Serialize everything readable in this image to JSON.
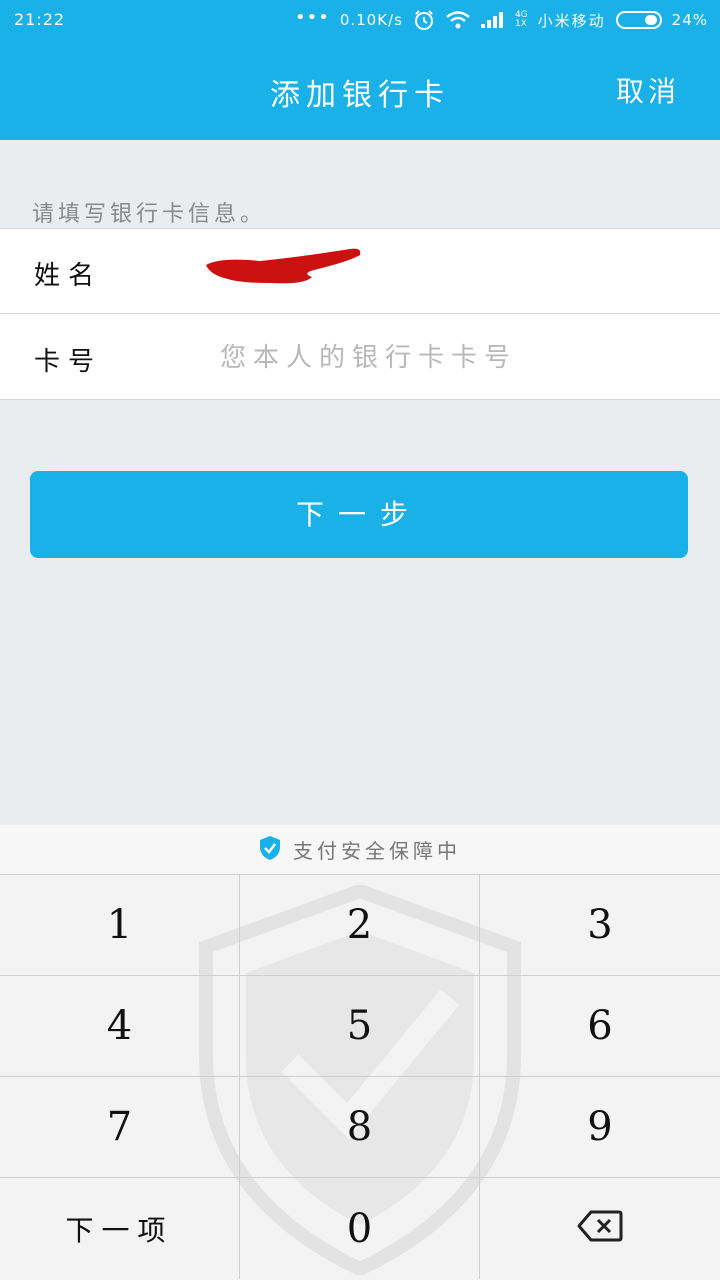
{
  "status_bar": {
    "time": "21:22",
    "dots": "•••",
    "net_speed": "0.10K/s",
    "net_type_top": "4G",
    "net_type_bottom": "1X",
    "carrier": "小米移动",
    "battery": "24%",
    "battery_level": 0.24
  },
  "header": {
    "title": "添加银行卡",
    "cancel_label": "取消"
  },
  "hint": "请填写银行卡信息。",
  "form": {
    "name_label": "姓名",
    "card_label": "卡号",
    "card_placeholder": "您本人的银行卡卡号"
  },
  "next_button": "下一步",
  "keyboard": {
    "secure_text": "支付安全保障中",
    "keys": [
      "1",
      "2",
      "3",
      "4",
      "5",
      "6",
      "7",
      "8",
      "9"
    ],
    "next_item": "下一项",
    "zero": "0"
  },
  "colors": {
    "accent": "#1ab0e8",
    "background": "#e9edef",
    "redaction": "#cc1111"
  },
  "icons": [
    "alarm-icon",
    "wifi-icon",
    "signal-icon",
    "battery-icon",
    "shield-check-icon",
    "backspace-icon"
  ]
}
